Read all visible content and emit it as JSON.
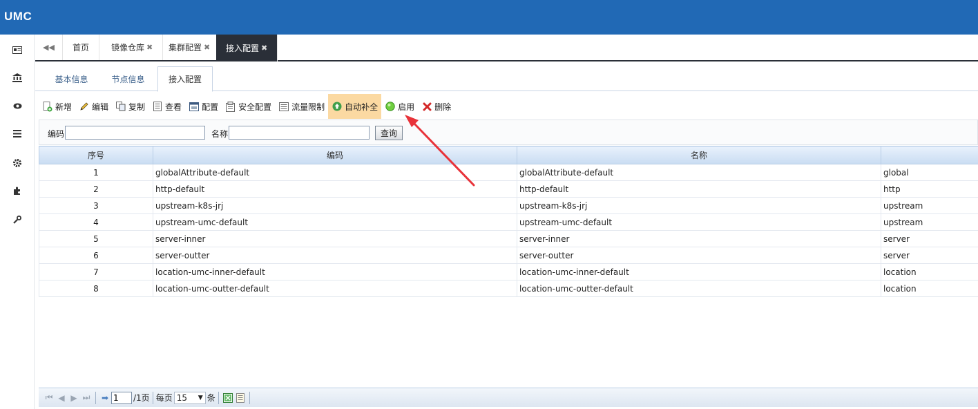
{
  "app": {
    "title": "UMC"
  },
  "sidebar": {
    "icons": [
      "id-card-icon",
      "bank-icon",
      "eye-icon",
      "list-icon",
      "gear-icon",
      "puzzle-icon",
      "wrench-icon"
    ]
  },
  "tabs": [
    {
      "label": "首页",
      "closable": false
    },
    {
      "label": "镜像仓库",
      "closable": true
    },
    {
      "label": "集群配置",
      "closable": true
    },
    {
      "label": "接入配置",
      "closable": true,
      "active": true
    }
  ],
  "close_glyph": "✖",
  "subtabs": [
    {
      "label": "基本信息"
    },
    {
      "label": "节点信息"
    },
    {
      "label": "接入配置",
      "active": true
    }
  ],
  "toolbar": {
    "add": "新增",
    "edit": "编辑",
    "copy": "复制",
    "view": "查看",
    "config": "配置",
    "security": "安全配置",
    "rate_limit": "流量限制",
    "auto_complete": "自动补全",
    "enable": "启用",
    "delete": "删除"
  },
  "search": {
    "code_label": "编码",
    "code_value": "",
    "name_label": "名称",
    "name_value": "",
    "query_button": "查询"
  },
  "table": {
    "headers": [
      "序号",
      "编码",
      "名称",
      ""
    ],
    "rows": [
      [
        "1",
        "globalAttribute-default",
        "globalAttribute-default",
        "global"
      ],
      [
        "2",
        "http-default",
        "http-default",
        "http"
      ],
      [
        "3",
        "upstream-k8s-jrj",
        "upstream-k8s-jrj",
        "upstream"
      ],
      [
        "4",
        "upstream-umc-default",
        "upstream-umc-default",
        "upstream"
      ],
      [
        "5",
        "server-inner",
        "server-inner",
        "server"
      ],
      [
        "6",
        "server-outter",
        "server-outter",
        "server"
      ],
      [
        "7",
        "location-umc-inner-default",
        "location-umc-inner-default",
        "location"
      ],
      [
        "8",
        "location-umc-outter-default",
        "location-umc-outter-default",
        "location"
      ]
    ]
  },
  "pager": {
    "page": "1",
    "total_pages": "/1页",
    "per_page_label": "每页",
    "per_page": "15",
    "unit": "条"
  },
  "colors": {
    "header_bg": "#2169b5",
    "active_tab_bg": "#2a2f38",
    "highlight": "#fbd9a2",
    "arrow": "#e8333a"
  }
}
